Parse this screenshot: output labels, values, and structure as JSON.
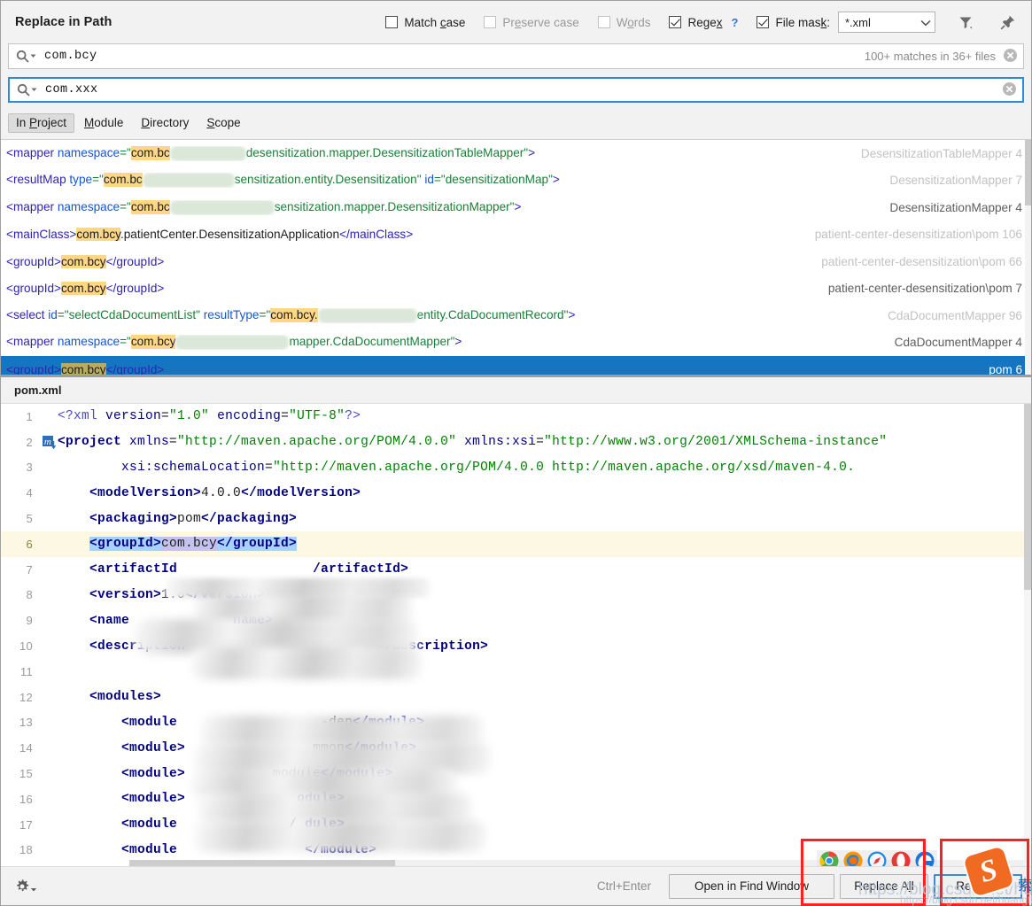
{
  "dialog": {
    "title": "Replace in Path"
  },
  "options": {
    "match_case": {
      "label_pre": "Match ",
      "label_u": "c",
      "label_post": "ase",
      "checked": false,
      "enabled": true
    },
    "preserve_case": {
      "label_pre": "Pr",
      "label_u": "e",
      "label_post": "serve case",
      "checked": false,
      "enabled": false
    },
    "words": {
      "label_pre": "W",
      "label_u": "o",
      "label_post": "rds",
      "checked": false,
      "enabled": false
    },
    "regex": {
      "label_pre": "Rege",
      "label_u": "x",
      "label_post": "",
      "checked": true,
      "enabled": true,
      "help": "?"
    },
    "file_mask": {
      "label_pre": "File mas",
      "label_u": "k",
      "label_post": ":",
      "checked": true,
      "enabled": true,
      "value": "*.xml"
    },
    "filter_icon": "filter-icon",
    "pin_icon": "pin-icon"
  },
  "search": {
    "find_value": "com.bcy",
    "replace_value": "com.xxx",
    "matches_status": "100+ matches in 36+ files",
    "search_icon": "search-icon",
    "clear_icon": "clear-icon"
  },
  "scopes": {
    "items": [
      {
        "pre": "In ",
        "u": "P",
        "post": "roject",
        "active": true
      },
      {
        "pre": "",
        "u": "M",
        "post": "odule",
        "active": false
      },
      {
        "pre": "",
        "u": "D",
        "post": "irectory",
        "active": false
      },
      {
        "pre": "",
        "u": "S",
        "post": "cope",
        "active": false
      }
    ]
  },
  "results": {
    "rows": [
      {
        "selected": true,
        "segments": [
          {
            "t": "<groupId>",
            "c": "tagc"
          },
          {
            "t": "com.bcy",
            "c": "punc",
            "hl": true
          },
          {
            "t": "</groupId>",
            "c": "tagc"
          }
        ],
        "file": "pom 6",
        "dim": false
      },
      {
        "selected": false,
        "segments": [
          {
            "t": "<mapper ",
            "c": "tagc"
          },
          {
            "t": "namespace",
            "c": "attrc"
          },
          {
            "t": "=\"",
            "c": "strc"
          },
          {
            "t": "com.bcy",
            "c": "punc",
            "hl": true
          },
          {
            "t": "__BLURG1__",
            "c": "blur"
          },
          {
            "t": "mapper.CdaDocumentMapper\"",
            "c": "strc"
          },
          {
            "t": ">",
            "c": "tagc"
          }
        ],
        "file": "CdaDocumentMapper 4",
        "dim": false
      },
      {
        "selected": false,
        "segments": [
          {
            "t": "<select ",
            "c": "tagc"
          },
          {
            "t": "id",
            "c": "attrc"
          },
          {
            "t": "=\"selectCdaDocumentList\" ",
            "c": "strc"
          },
          {
            "t": "resultType",
            "c": "attrc"
          },
          {
            "t": "=\"",
            "c": "strc"
          },
          {
            "t": "com.bcy.",
            "c": "punc",
            "hl": true
          },
          {
            "t": "__BLURG2__",
            "c": "blur"
          },
          {
            "t": "entity.CdaDocumentRecord\"",
            "c": "strc"
          },
          {
            "t": ">",
            "c": "tagc"
          }
        ],
        "file": "CdaDocumentMapper 96",
        "dim": true
      },
      {
        "selected": false,
        "segments": [
          {
            "t": "<groupId>",
            "c": "tagc"
          },
          {
            "t": "com.bcy",
            "c": "punc",
            "hl": true
          },
          {
            "t": "</groupId>",
            "c": "tagc"
          }
        ],
        "file": "patient-center-desensitization\\pom 7",
        "dim": false
      },
      {
        "selected": false,
        "segments": [
          {
            "t": "<groupId>",
            "c": "tagc"
          },
          {
            "t": "com.bcy",
            "c": "punc",
            "hl": true
          },
          {
            "t": "</groupId>",
            "c": "tagc"
          }
        ],
        "file": "patient-center-desensitization\\pom 66",
        "dim": true
      },
      {
        "selected": false,
        "segments": [
          {
            "t": "<mainClass>",
            "c": "tagc"
          },
          {
            "t": "com.bcy",
            "c": "punc",
            "hl": true
          },
          {
            "t": ".patientCenter.DesensitizationApplication",
            "c": "punc"
          },
          {
            "t": "</mainClass>",
            "c": "tagc"
          }
        ],
        "file": "patient-center-desensitization\\pom 106",
        "dim": true
      },
      {
        "selected": false,
        "segments": [
          {
            "t": "<mapper ",
            "c": "tagc"
          },
          {
            "t": "namespace",
            "c": "attrc"
          },
          {
            "t": "=\"",
            "c": "strc"
          },
          {
            "t": "com.bc",
            "c": "punc",
            "hl": true
          },
          {
            "t": "__BLURG3__",
            "c": "blur"
          },
          {
            "t": "sensitization.mapper.DesensitizationMapper\"",
            "c": "strc"
          },
          {
            "t": ">",
            "c": "tagc"
          }
        ],
        "file": "DesensitizationMapper 4",
        "dim": false
      },
      {
        "selected": false,
        "segments": [
          {
            "t": "<resultMap ",
            "c": "tagc"
          },
          {
            "t": "type",
            "c": "attrc"
          },
          {
            "t": "=\"",
            "c": "strc"
          },
          {
            "t": "com.bc",
            "c": "punc",
            "hl": true
          },
          {
            "t": "__BLURG4__",
            "c": "blur"
          },
          {
            "t": "sensitization.entity.Desensitization\" ",
            "c": "strc"
          },
          {
            "t": "id",
            "c": "attrc"
          },
          {
            "t": "=\"desensitizationMap\"",
            "c": "strc"
          },
          {
            "t": ">",
            "c": "tagc"
          }
        ],
        "file": "DesensitizationMapper 7",
        "dim": true
      },
      {
        "selected": false,
        "segments": [
          {
            "t": "<mapper ",
            "c": "tagc"
          },
          {
            "t": "namespace",
            "c": "attrc"
          },
          {
            "t": "=\"",
            "c": "strc"
          },
          {
            "t": "com.bc",
            "c": "punc",
            "hl": true
          },
          {
            "t": "__BLURG5__",
            "c": "blur"
          },
          {
            "t": "desensitization.mapper.DesensitizationTableMapper\"",
            "c": "strc"
          },
          {
            "t": ">",
            "c": "tagc"
          }
        ],
        "file": "DesensitizationTableMapper 4",
        "dim": true
      }
    ]
  },
  "preview": {
    "filename": "pom.xml",
    "lines": [
      {
        "n": "1",
        "tokens": [
          {
            "t": "<?xml ",
            "c": "k-meta"
          },
          {
            "t": "version",
            "c": "k-attr"
          },
          {
            "t": "=",
            "c": "k-txt"
          },
          {
            "t": "\"1.0\"",
            "c": "k-str"
          },
          {
            "t": " ",
            "c": "k-txt"
          },
          {
            "t": "encoding",
            "c": "k-attr"
          },
          {
            "t": "=",
            "c": "k-txt"
          },
          {
            "t": "\"UTF-8\"",
            "c": "k-str"
          },
          {
            "t": "?>",
            "c": "k-meta"
          }
        ]
      },
      {
        "n": "2",
        "marker": "maven-icon",
        "tokens": [
          {
            "t": "<project ",
            "c": "k-tag"
          },
          {
            "t": "xmlns",
            "c": "k-attr"
          },
          {
            "t": "=",
            "c": "k-txt"
          },
          {
            "t": "\"http://maven.apache.org/POM/4.0.0\"",
            "c": "k-str"
          },
          {
            "t": " ",
            "c": "k-txt"
          },
          {
            "t": "xmlns:xsi",
            "c": "k-attr"
          },
          {
            "t": "=",
            "c": "k-txt"
          },
          {
            "t": "\"http://www.w3.org/2001/XMLSchema-instance\"",
            "c": "k-str"
          }
        ]
      },
      {
        "n": "3",
        "tokens": [
          {
            "t": "        ",
            "c": "k-txt"
          },
          {
            "t": "xsi:schemaLocation",
            "c": "k-attr"
          },
          {
            "t": "=",
            "c": "k-txt"
          },
          {
            "t": "\"http://maven.apache.org/POM/4.0.0 http://maven.apache.org/xsd/maven-4.0.",
            "c": "k-str"
          }
        ]
      },
      {
        "n": "4",
        "tokens": [
          {
            "t": "    ",
            "c": "k-txt"
          },
          {
            "t": "<modelVersion>",
            "c": "k-tag"
          },
          {
            "t": "4.0.0",
            "c": "k-txt"
          },
          {
            "t": "</modelVersion>",
            "c": "k-tag"
          }
        ]
      },
      {
        "n": "5",
        "tokens": [
          {
            "t": "    ",
            "c": "k-txt"
          },
          {
            "t": "<packaging>",
            "c": "k-tag"
          },
          {
            "t": "pom",
            "c": "k-txt"
          },
          {
            "t": "</packaging>",
            "c": "k-tag"
          }
        ]
      },
      {
        "n": "6",
        "current": true,
        "tokens": [
          {
            "t": "    ",
            "c": "k-txt"
          },
          {
            "t": "<groupId>",
            "c": "k-tag sel-blue"
          },
          {
            "t": "com.bcy",
            "c": "k-txt sel-lav"
          },
          {
            "t": "</groupId>",
            "c": "k-tag sel-blue"
          }
        ]
      },
      {
        "n": "7",
        "tokens": [
          {
            "t": "    ",
            "c": "k-txt"
          },
          {
            "t": "<artifactId",
            "c": "k-tag"
          },
          {
            "t": "                 ",
            "c": "k-txt"
          },
          {
            "t": "/artifactId>",
            "c": "k-tag"
          }
        ]
      },
      {
        "n": "8",
        "tokens": [
          {
            "t": "    ",
            "c": "k-txt"
          },
          {
            "t": "<version>",
            "c": "k-tag"
          },
          {
            "t": "1.0",
            "c": "k-txt"
          },
          {
            "t": "</version>",
            "c": "k-tag"
          }
        ]
      },
      {
        "n": "9",
        "tokens": [
          {
            "t": "    ",
            "c": "k-txt"
          },
          {
            "t": "<name",
            "c": "k-tag"
          },
          {
            "t": "             ",
            "c": "k-txt"
          },
          {
            "t": "name>",
            "c": "k-tag"
          }
        ]
      },
      {
        "n": "10",
        "tokens": [
          {
            "t": "    ",
            "c": "k-txt"
          },
          {
            "t": "<description",
            "c": "k-tag"
          },
          {
            "t": "                        ",
            "c": "k-txt"
          },
          {
            "t": "</description>",
            "c": "k-tag"
          }
        ]
      },
      {
        "n": "11",
        "tokens": []
      },
      {
        "n": "12",
        "tokens": [
          {
            "t": "    ",
            "c": "k-txt"
          },
          {
            "t": "<modules>",
            "c": "k-tag"
          }
        ]
      },
      {
        "n": "13",
        "tokens": [
          {
            "t": "        ",
            "c": "k-txt"
          },
          {
            "t": "<module",
            "c": "k-tag"
          },
          {
            "t": "                  ",
            "c": "k-txt"
          },
          {
            "t": "-dep",
            "c": "k-txt"
          },
          {
            "t": "</module>",
            "c": "k-tag"
          }
        ]
      },
      {
        "n": "14",
        "tokens": [
          {
            "t": "        ",
            "c": "k-txt"
          },
          {
            "t": "<module>",
            "c": "k-tag"
          },
          {
            "t": "                ",
            "c": "k-txt"
          },
          {
            "t": "mmon",
            "c": "k-txt"
          },
          {
            "t": "</module>",
            "c": "k-tag"
          }
        ]
      },
      {
        "n": "15",
        "tokens": [
          {
            "t": "        ",
            "c": "k-txt"
          },
          {
            "t": "<module>",
            "c": "k-tag"
          },
          {
            "t": "           ",
            "c": "k-txt"
          },
          {
            "t": "module",
            "c": "k-txt"
          },
          {
            "t": "</module>",
            "c": "k-tag"
          }
        ]
      },
      {
        "n": "16",
        "tokens": [
          {
            "t": "        ",
            "c": "k-txt"
          },
          {
            "t": "<module>",
            "c": "k-tag"
          },
          {
            "t": "              ",
            "c": "k-txt"
          },
          {
            "t": "odule>",
            "c": "k-tag"
          }
        ]
      },
      {
        "n": "17",
        "tokens": [
          {
            "t": "        ",
            "c": "k-txt"
          },
          {
            "t": "<module",
            "c": "k-tag"
          },
          {
            "t": "              ",
            "c": "k-txt"
          },
          {
            "t": "/ dule>",
            "c": "k-tag"
          }
        ]
      },
      {
        "n": "18",
        "tokens": [
          {
            "t": "        ",
            "c": "k-txt"
          },
          {
            "t": "<module",
            "c": "k-tag"
          },
          {
            "t": "                ",
            "c": "k-txt"
          },
          {
            "t": "</module>",
            "c": "k-tag"
          }
        ]
      }
    ],
    "browser_icons": [
      "chrome-icon",
      "firefox-icon",
      "safari-icon",
      "opera-icon",
      "edge-icon"
    ]
  },
  "footer": {
    "settings_icon": "gear-icon",
    "shortcut": "Ctrl+Enter",
    "open_in_find_window": "Open in Find Window",
    "replace_all": {
      "pre": "Replace A",
      "u": "l",
      "post": "l"
    },
    "replace": "Replace"
  },
  "watermarks": {
    "url": "https://blog.csdn.net/huangfls",
    "sogou_letter": "S",
    "sogou_cn": "索"
  },
  "colors": {
    "selection_blue": "#1675c0",
    "highlight_yellow": "#ffd787",
    "annotation_red": "#ff2020",
    "accent_blue": "#2f8ad8"
  }
}
